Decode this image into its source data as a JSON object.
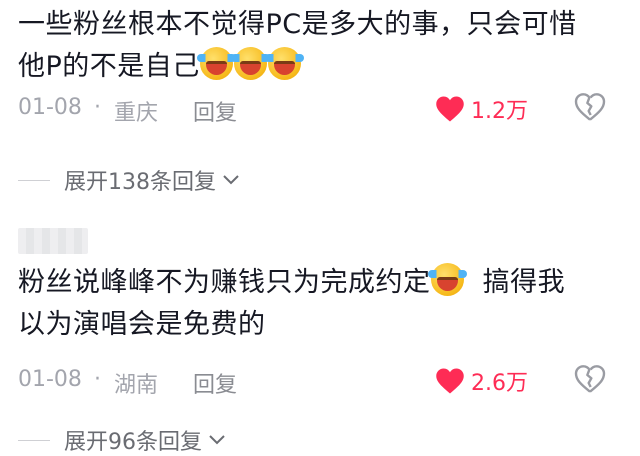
{
  "comments": [
    {
      "text_line1": "一些粉丝根本不觉得PC是多大的事，只会可惜",
      "text_line2": "他P的不是自己",
      "emojis": [
        "laugh-cry-emoji",
        "laugh-cry-emoji",
        "laugh-cry-emoji"
      ],
      "date": "01-08",
      "sep": "·",
      "location": "重庆",
      "reply_label": "回复",
      "likes": "1.2万",
      "expand_label": "展开138条回复"
    },
    {
      "text_line1_a": "粉丝说峰峰不为赚钱只为完成约定",
      "text_line1_b": "搞得我",
      "text_line2": "以为演唱会是免费的",
      "date": "01-08",
      "sep": "·",
      "location": "湖南",
      "reply_label": "回复",
      "likes": "2.6万",
      "expand_label": "展开96条回复"
    }
  ],
  "colors": {
    "like": "#fe2c55",
    "meta": "#a3a5ad",
    "text": "#161823"
  }
}
